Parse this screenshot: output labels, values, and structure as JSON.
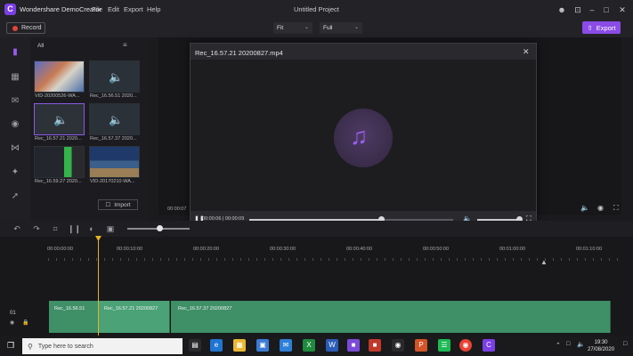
{
  "app": {
    "logo_letter": "C",
    "name": "Wondershare DemoCreator",
    "menu": [
      "File",
      "Edit",
      "Export",
      "Help"
    ],
    "window_title": "Untitled Project"
  },
  "toolbar": {
    "record_label": "Record",
    "fit_value": "Fit",
    "quality_value": "Full",
    "export_label": "Export"
  },
  "sidebar": {
    "icons": [
      "folder-icon",
      "calendar-icon",
      "caption-icon",
      "sticker-icon",
      "transition-icon",
      "effects-icon",
      "cursor-icon"
    ]
  },
  "media": {
    "filter": "All",
    "items": [
      {
        "label": "VID-20200526-WA...",
        "kind": "video"
      },
      {
        "label": "Rec_16.56.51 2020...",
        "kind": "audio"
      },
      {
        "label": "Rec_16.57.21 2020...",
        "kind": "audio",
        "selected": true
      },
      {
        "label": "Rec_16.57.37 2020...",
        "kind": "audio"
      },
      {
        "label": "Rec_16.59.27 2020...",
        "kind": "video"
      },
      {
        "label": "VID-20170210-WA...",
        "kind": "video"
      }
    ],
    "import_label": "Import"
  },
  "preview": {
    "time_left": "00:00:07"
  },
  "dialog": {
    "title": "Rec_16.57.21 20200827.mp4",
    "time": "00:00:06 | 00:00:09",
    "progress": 0.65,
    "volume": 0.9
  },
  "timeline": {
    "ruler": [
      "00:00:00:00",
      "00:00:10:00",
      "00:00:20:00",
      "00:00:30:00",
      "00:00:40:00",
      "00:00:50:00",
      "00:01:00:00",
      "00:01:10:00"
    ],
    "track_number": "01",
    "clips": [
      {
        "label": "Rec_16.56.51"
      },
      {
        "label": "Rec_16.57.21 20200827"
      },
      {
        "label": "Rec_16.57.37 20200827"
      }
    ]
  },
  "taskbar": {
    "search_placeholder": "Type here to search",
    "time": "19:30",
    "date": "27/08/2020"
  },
  "colors": {
    "accent": "#8a4be6",
    "clip": "#3f8f67",
    "playhead": "#e8b21e"
  }
}
